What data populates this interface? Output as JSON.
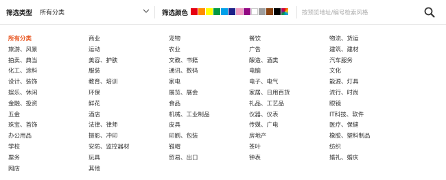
{
  "filter_bar": {
    "type_label": "筛选类型",
    "type_value": "所有分类",
    "color_label": "筛选颜色",
    "colors": [
      "#e60012",
      "#ff8c00",
      "#ffff00",
      "#009944",
      "#00a0e9",
      "#1d2088",
      "#f19ec2",
      "#920783",
      "#ffffff",
      "#9e9e9e",
      "#8b4513",
      "#000000",
      "multicolor"
    ],
    "search_placeholder": "按预览地址/编号检索风格",
    "search_icon": "search-icon"
  },
  "categories": {
    "columns": [
      [
        "所有分类",
        "旅游、风景",
        "拍卖、典当",
        "化工、涂料",
        "设计、装饰",
        "娱乐、休闲",
        "金融、投资",
        "五金",
        "珠宝、首饰",
        "办公用品",
        "学校",
        "票务",
        "网店"
      ],
      [
        "商业",
        "运动",
        "美容、护肤",
        "服装",
        "教育、培训",
        "环保",
        "鲜花",
        "酒店",
        "法律、律师",
        "摄影、冲印",
        "安防、监控器材",
        "玩具",
        "其他"
      ],
      [
        "宠物",
        "农业",
        "文教、书籍",
        "通讯、数码",
        "家电",
        "展览、展会",
        "食品",
        "机械、工业制品",
        "皮具",
        "印刷、包装",
        "鞋帽",
        "贸易、出口"
      ],
      [
        "餐饮",
        "广告",
        "酿造、酒类",
        "电脑",
        "电子、电气",
        "家居、日用百货",
        "礼品、工艺品",
        "仪器、仪表",
        "传媒、广电",
        "房地产",
        "茶叶",
        "钟表"
      ],
      [
        "物流、货运",
        "建筑、建材",
        "汽车服务",
        "文化",
        "能源、灯具",
        "流行、时尚",
        "眼镜",
        "IT科技、软件",
        "医疗、保健",
        "橡胶、塑料制品",
        "纺织",
        "婚礼、婚庆"
      ]
    ],
    "active": "所有分类",
    "active_color": "#e8541e"
  }
}
